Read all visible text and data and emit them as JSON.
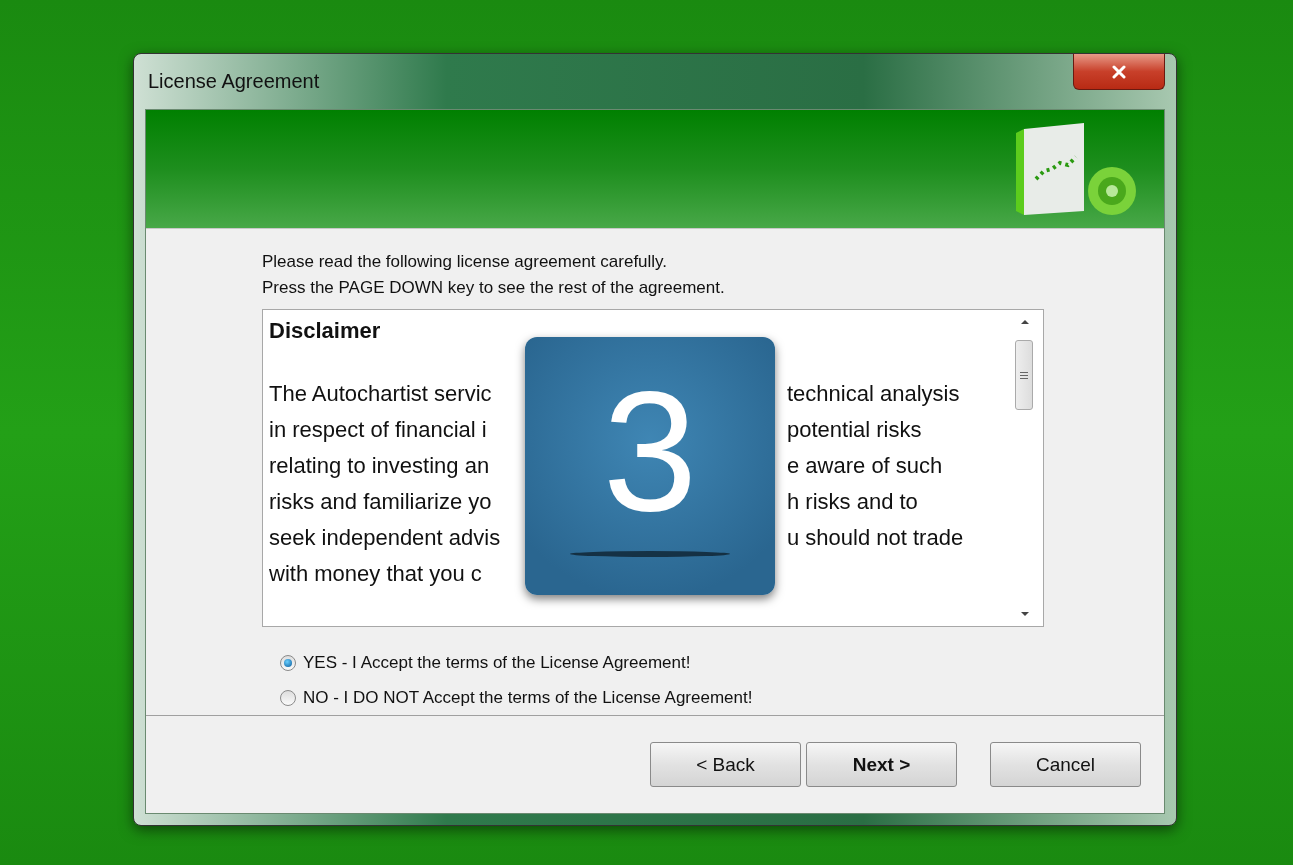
{
  "window": {
    "title": "License Agreement"
  },
  "instructions": [
    "Please read the following license agreement carefully.",
    "Press the PAGE DOWN key to see the rest of the agreement."
  ],
  "agreement": {
    "heading": "Disclaimer",
    "lines": [
      {
        "left": "The Autochartist servic",
        "right": "technical analysis"
      },
      {
        "left": "in respect of financial i",
        "right": "potential risks"
      },
      {
        "left": "relating to investing an",
        "right": "e aware of such"
      },
      {
        "left": "risks and familiarize yo",
        "right": "h risks and to"
      },
      {
        "left": "seek independent advis",
        "right": "u should not trade"
      },
      {
        "left": "with money that you c"
      }
    ]
  },
  "step_badge": {
    "label": "3"
  },
  "options": [
    {
      "label": "YES - I Accept the terms of the License Agreement!",
      "selected": true
    },
    {
      "label": "NO - I DO NOT Accept the terms of the License Agreement!",
      "selected": false
    }
  ],
  "buttons": [
    {
      "label": "< Back",
      "kind": "normal"
    },
    {
      "label": "Next >",
      "kind": "default"
    },
    {
      "label": "Cancel",
      "kind": "normal"
    }
  ]
}
